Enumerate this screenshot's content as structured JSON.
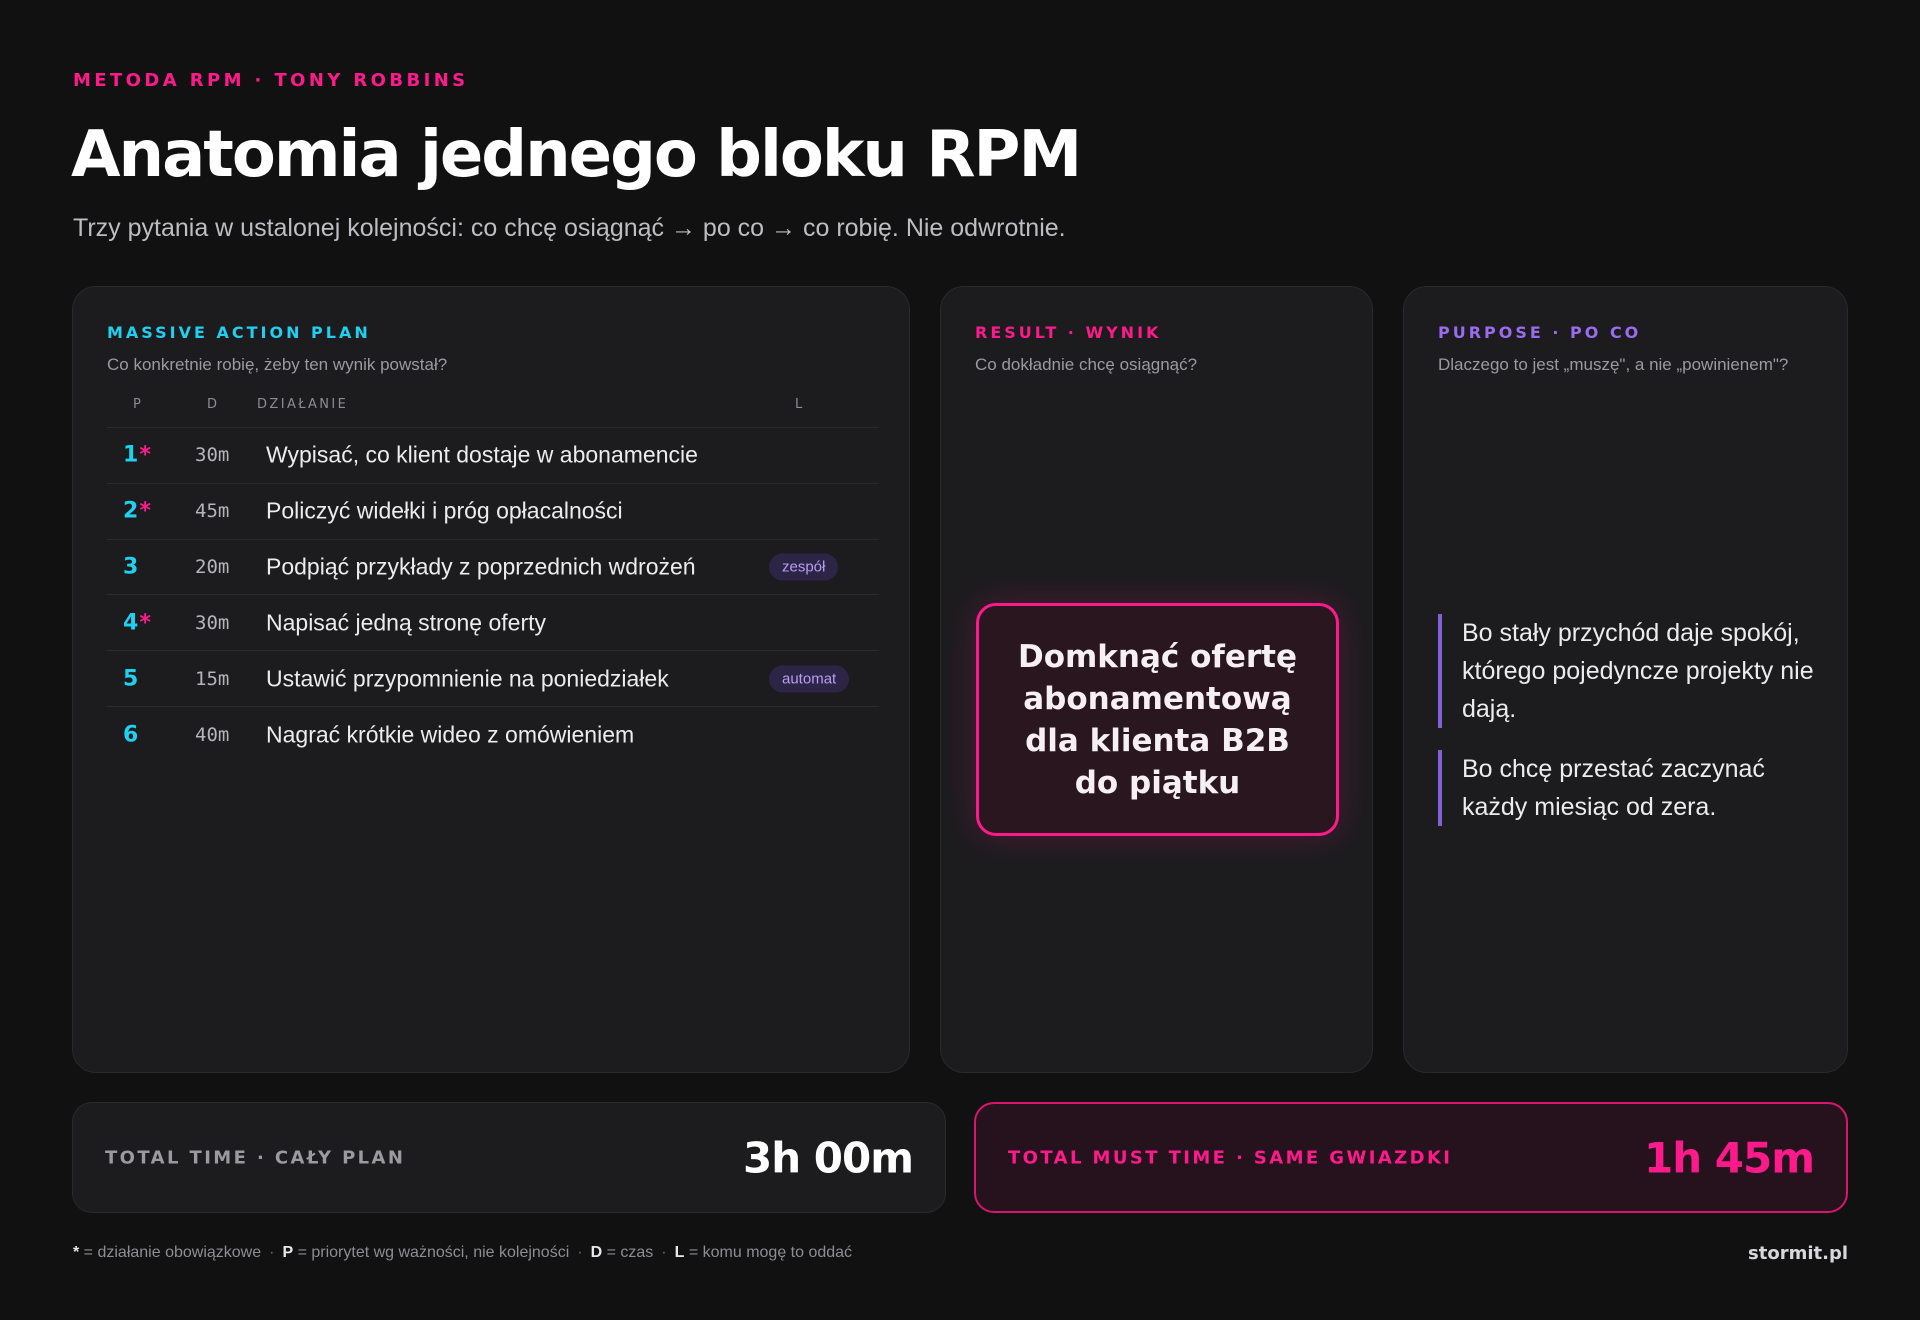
{
  "header": {
    "eyebrow": "METODA RPM · TONY ROBBINS",
    "title": "Anatomia jednego bloku RPM",
    "subtitle": "Trzy pytania w ustalonej kolejności: co chcę osiągnąć → po co → co robię. Nie odwrotnie."
  },
  "colors": {
    "accent_pink": "#ff1a8c",
    "accent_cyan": "#1fd0f0",
    "accent_violet": "#9b6cf0",
    "background": "#111112",
    "card": "#1c1c1e"
  },
  "massive_action_plan": {
    "label": "MASSIVE ACTION PLAN",
    "hint": "Co konkretnie robię, żeby ten wynik powstał?",
    "columns": {
      "p": "P",
      "d": "D",
      "action": "DZIAŁANIE",
      "l": "L"
    },
    "rows": [
      {
        "priority": "1",
        "star": "*",
        "duration": "30m",
        "action": "Wypisać, co klient dostaje w abonamencie",
        "leverage": ""
      },
      {
        "priority": "2",
        "star": "*",
        "duration": "45m",
        "action": "Policzyć widełki i próg opłacalności",
        "leverage": ""
      },
      {
        "priority": "3",
        "star": "",
        "duration": "20m",
        "action": "Podpiąć przykłady z poprzednich wdrożeń",
        "leverage": "zespół"
      },
      {
        "priority": "4",
        "star": "*",
        "duration": "30m",
        "action": "Napisać jedną stronę oferty",
        "leverage": ""
      },
      {
        "priority": "5",
        "star": "",
        "duration": "15m",
        "action": "Ustawić przypomnienie na poniedziałek",
        "leverage": "automat"
      },
      {
        "priority": "6",
        "star": "",
        "duration": "40m",
        "action": "Nagrać krótkie wideo z omówieniem",
        "leverage": ""
      }
    ]
  },
  "result": {
    "label": "RESULT · WYNIK",
    "hint": "Co dokładnie chcę osiągnąć?",
    "statement": "Domknąć ofertę abonamentową dla klienta B2B do piątku"
  },
  "purpose": {
    "label": "PURPOSE · PO CO",
    "hint": "Dlaczego to jest „muszę\", a nie „powinienem\"?",
    "reasons": [
      "Bo stały przychód daje spokój, którego pojedyncze projekty nie dają.",
      "Bo chcę przestać zaczynać każdy miesiąc od zera."
    ]
  },
  "totals": {
    "all_label": "TOTAL TIME · CAŁY PLAN",
    "all_value": "3h 00m",
    "must_label": "TOTAL MUST TIME · SAME GWIAZDKI",
    "must_value": "1h 45m"
  },
  "footer": {
    "legend": [
      {
        "key": "*",
        "text": " = działanie obowiązkowe"
      },
      {
        "key": "P",
        "text": " = priorytet wg ważności, nie kolejności"
      },
      {
        "key": "D",
        "text": " = czas"
      },
      {
        "key": "L",
        "text": " = komu mogę to oddać"
      }
    ],
    "separator": "·",
    "brand": "stormit.pl"
  }
}
